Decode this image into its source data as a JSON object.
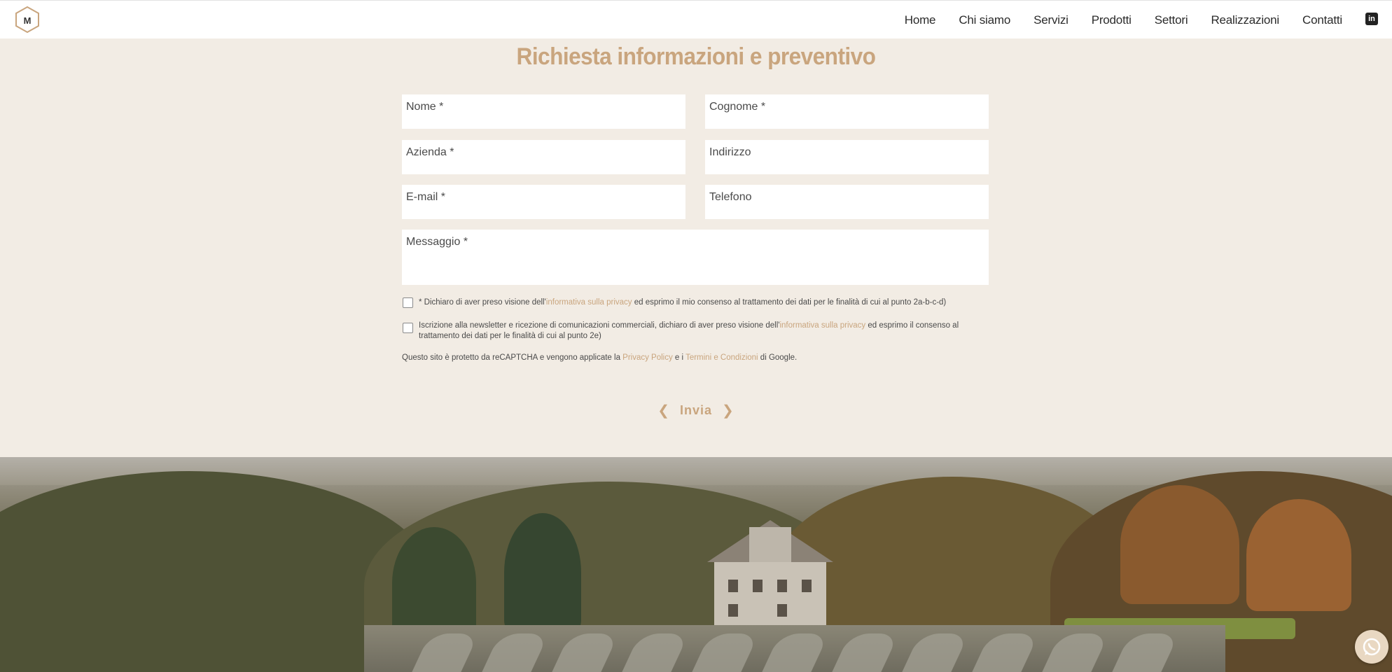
{
  "header": {
    "logo_letter": "M",
    "nav": [
      "Home",
      "Chi siamo",
      "Servizi",
      "Prodotti",
      "Settori",
      "Realizzazioni",
      "Contatti"
    ],
    "linkedin_label": "in"
  },
  "form": {
    "title": "Richiesta informazioni e preventivo",
    "fields": {
      "nome": "Nome *",
      "cognome": "Cognome *",
      "azienda": "Azienda *",
      "indirizzo": "Indirizzo",
      "email": "E-mail *",
      "telefono": "Telefono",
      "messaggio": "Messaggio *"
    },
    "consent1": {
      "pre": "* Dichiaro di aver preso visione dell'",
      "link": "informativa sulla privacy",
      "post": " ed esprimo il mio consenso al trattamento dei dati per le finalità di cui al punto 2a-b-c-d)"
    },
    "consent2": {
      "pre": "Iscrizione alla newsletter e ricezione di comunicazioni commerciali, dichiaro di aver preso visione dell'",
      "link": "informativa sulla privacy",
      "post": " ed esprimo il consenso al trattamento dei dati per le finalità di cui al punto 2e)"
    },
    "recaptcha": {
      "pre": "Questo sito è protetto da reCAPTCHA e vengono applicate la ",
      "privacy_link": "Privacy Policy",
      "mid": " e i ",
      "terms_link": "Termini e Condizioni",
      "post": " di Google."
    },
    "submit": {
      "label": "Invia",
      "left_chevron": "❮",
      "right_chevron": "❯"
    }
  },
  "colors": {
    "accent": "#c9a57e",
    "background": "#f2ece4"
  }
}
